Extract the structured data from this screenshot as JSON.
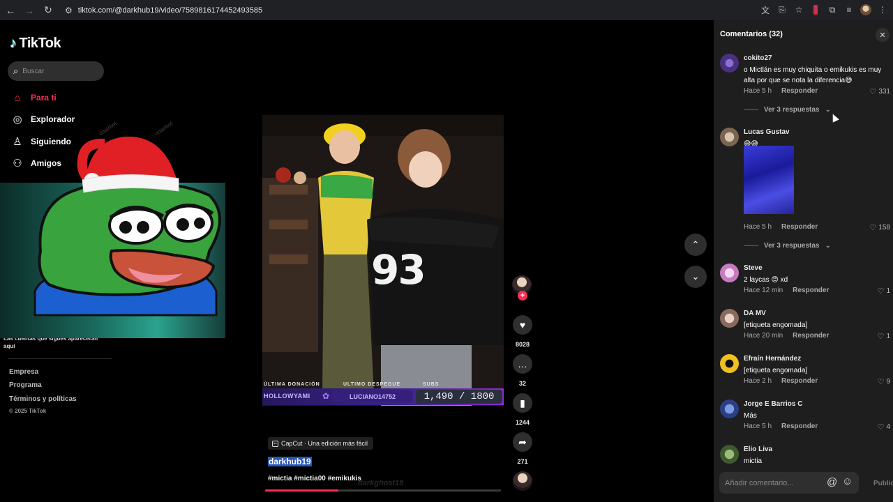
{
  "browser": {
    "url": "tiktok.com/@darkhub19/video/7589816174452493585",
    "icons": [
      "back-icon",
      "forward-icon",
      "reload-icon",
      "site-settings-icon",
      "translate-icon",
      "cast-icon",
      "star-icon",
      "extension-icon",
      "puzzle-icon",
      "media-icon",
      "profile-icon",
      "menu-icon"
    ]
  },
  "sidebar": {
    "logo": "TikTok",
    "search_placeholder": "Buscar",
    "items": [
      {
        "label": "Para ti",
        "icon": "home-icon",
        "active": true
      },
      {
        "label": "Explorador",
        "icon": "compass-icon"
      },
      {
        "label": "Siguiendo",
        "icon": "following-icon"
      },
      {
        "label": "Amigos",
        "icon": "friends-icon"
      }
    ],
    "note": "Las cuentas que sigues aparecerán aquí",
    "footer": [
      "Empresa",
      "Programa",
      "Términos y políticas"
    ],
    "copyright": "© 2025 TikTok"
  },
  "stream_overlay": {
    "labels": [
      "ÚLTIMA DONACIÓN",
      "ULTIMO DESPEGUE",
      "SUBS"
    ],
    "last_donation": "HOLLOWYAMI",
    "last_booster": "LUCIANO14752",
    "subs": "1,490 / 1800"
  },
  "video": {
    "jersey_number": "93",
    "capcut": "CapCut · Una edición más fácil",
    "username": "darkhub19",
    "hashtags": "#mictia #mictia00 #emikukis",
    "watermark": "darkghost19",
    "progress": 0.31,
    "likes": "8028",
    "comments": "32",
    "saves": "1244",
    "shares": "271"
  },
  "comments": {
    "title": "Comentarios (32)",
    "input_placeholder": "Añadir comentario...",
    "publish": "Publicar",
    "reply_label": "Responder",
    "view_replies": "Ver 3 respuestas",
    "items": [
      {
        "name": "cokito27",
        "text": "o Mictlán es muy chiquita o emikukis es muy alta por que se nota la diferencia😅",
        "time": "Hace 5 h",
        "likes": "331",
        "avatar_color": "#5b3f8f"
      },
      {
        "name": "Lucas Gustav",
        "text": "😅😅",
        "time": "Hace 5 h",
        "likes": "158",
        "avatar_color": "#b39c86"
      },
      {
        "name": "Steve",
        "text": "2 laycas 😍 xd",
        "time": "Hace 12 min",
        "likes": "1",
        "avatar_color": "#d98bd0"
      },
      {
        "name": "DA MV",
        "text": "[etiqueta engomada]",
        "time": "Hace 20 min",
        "likes": "1",
        "avatar_color": "#a38478"
      },
      {
        "name": "Efraín Hernández",
        "text": "[etiqueta engomada]",
        "time": "Hace 2 h",
        "likes": "9",
        "avatar_color": "#f0c020"
      },
      {
        "name": "Jorge E Barrios C",
        "text": "Más",
        "time": "Hace 5 h",
        "likes": "4",
        "avatar_color": "#3a5ca8"
      },
      {
        "name": "Elio Liva",
        "text": "mictia",
        "time": "",
        "likes": "",
        "avatar_color": "#5a7a4a"
      }
    ]
  },
  "colors": {
    "accent": "#fe2c55",
    "panel": "#1e1e1e"
  }
}
